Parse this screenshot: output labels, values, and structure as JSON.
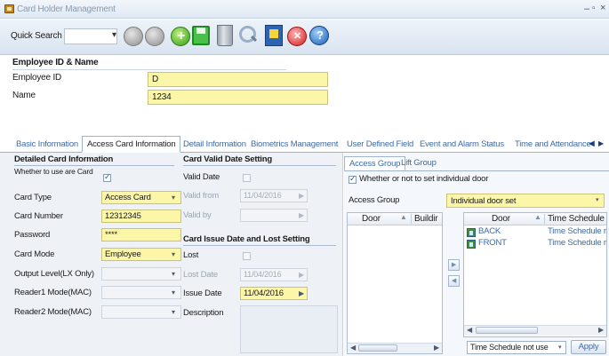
{
  "window": {
    "title": "Card Holder Management",
    "min": "–",
    "max": "▫",
    "close": "×"
  },
  "toolbar": {
    "quick_search_label": "Quick Search",
    "quick_search_value": "",
    "dropdown_arrow": "▾",
    "icons": [
      "prev-record-icon",
      "next-record-icon",
      "add-icon",
      "save-icon",
      "delete-icon",
      "search-icon",
      "export-icon",
      "cancel-icon",
      "help-icon"
    ]
  },
  "employee": {
    "header": "Employee ID & Name",
    "id_label": "Employee ID",
    "id_value": "D",
    "name_label": "Name",
    "name_value": "1234"
  },
  "tabs": {
    "items": [
      "Basic Information",
      "Access Card Information",
      "Detail Information",
      "Biometrics Management",
      "User Defined Field",
      "Event and Alarm Status",
      "Time and Attendance I"
    ],
    "active": "Access Card Information",
    "scroll_left": "◀",
    "scroll_right": "▶"
  },
  "detailed": {
    "title": "Detailed Card Information",
    "whether_label": "Whether to use are Card",
    "whether_checked": true,
    "card_type_label": "Card Type",
    "card_type_value": "Access Card",
    "card_number_label": "Card Number",
    "card_number_value": "12312345",
    "password_label": "Password",
    "password_value": "****",
    "card_mode_label": "Card Mode",
    "card_mode_value": "Employee",
    "output_level_label": "Output Level(LX Only)",
    "output_level_value": "",
    "reader1_label": "Reader1 Mode(MAC)",
    "reader1_value": "",
    "reader2_label": "Reader2 Mode(MAC)",
    "reader2_value": ""
  },
  "valid_date": {
    "title": "Card Valid Date Setting",
    "valid_date_label": "Valid Date",
    "valid_date_checked": false,
    "valid_from_label": "Valid from",
    "valid_from_value": "11/04/2016",
    "valid_by_label": "Valid by",
    "valid_by_value": ""
  },
  "issue": {
    "title": "Card Issue Date and Lost Setting",
    "lost_label": "Lost",
    "lost_checked": false,
    "lost_date_label": "Lost Date",
    "lost_date_value": "11/04/2016",
    "issue_date_label": "Issue Date",
    "issue_date_value": "11/04/2016",
    "description_label": "Description",
    "description_value": ""
  },
  "access": {
    "tab_access_group": "Access Group",
    "tab_lift_group": "Lift Group",
    "individual_label": "Whether or not to set individual door",
    "individual_checked": true,
    "access_group_label": "Access Group",
    "access_group_value": "Individual door set",
    "left_grid": {
      "headers": [
        "Door",
        "Buildir"
      ],
      "rows": []
    },
    "right_grid": {
      "headers": [
        "Door",
        "Time Schedule"
      ],
      "rows": [
        {
          "door": "BACK",
          "schedule": "Time Schedule r"
        },
        {
          "door": "FRONT",
          "schedule": "Time Schedule r"
        }
      ]
    },
    "move_right": "▶",
    "move_left": "◀",
    "time_schedule_value": "Time Schedule not use",
    "apply_label": "Apply"
  },
  "colors": {
    "highlight_field": "#fbf6a8",
    "link_blue": "#3f6aa3",
    "panel_bg": "#eef2f7"
  }
}
